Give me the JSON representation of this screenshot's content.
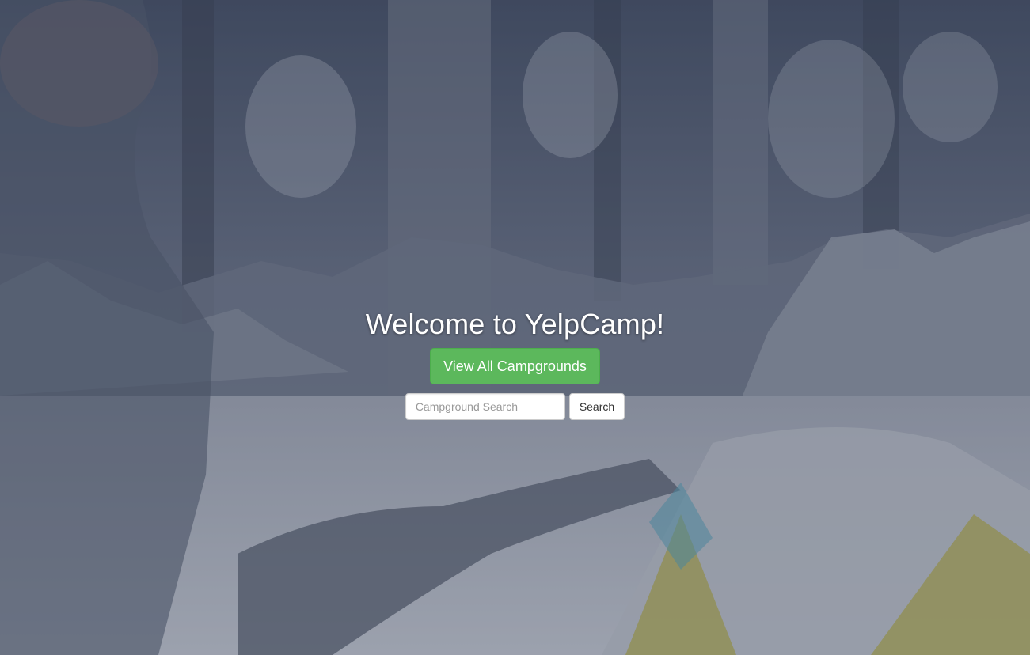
{
  "hero": {
    "title": "Welcome to YelpCamp!",
    "view_button_label": "View All Campgrounds"
  },
  "search": {
    "placeholder": "Campground Search",
    "value": "",
    "button_label": "Search"
  },
  "colors": {
    "primary_button": "#5cb85c",
    "title_text": "#ffffff",
    "overlay_tint": "#283042"
  }
}
